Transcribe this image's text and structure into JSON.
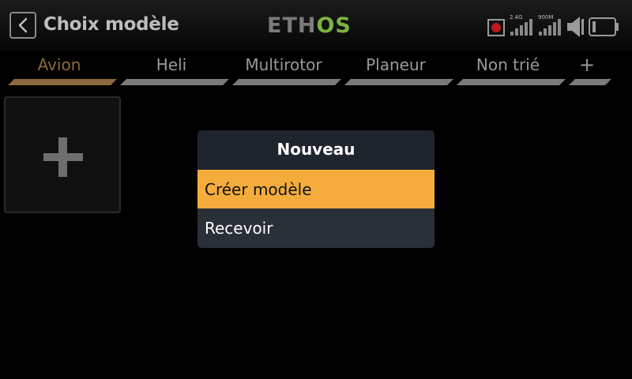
{
  "header": {
    "title": "Choix modèle",
    "back_icon": "chevron-left-icon",
    "logo": {
      "eth": "ETH",
      "os": "OS",
      "accent": "#7cb342"
    },
    "status": {
      "rf_label": "2.4G",
      "telemetry_label": "900M"
    }
  },
  "tabs": [
    {
      "label": "Avion",
      "active": true
    },
    {
      "label": "Heli",
      "active": false
    },
    {
      "label": "Multirotor",
      "active": false
    },
    {
      "label": "Planeur",
      "active": false
    },
    {
      "label": "Non trié",
      "active": false
    },
    {
      "label": "+",
      "active": false
    }
  ],
  "add_model_tile": {
    "icon": "plus-icon"
  },
  "popup": {
    "title": "Nouveau",
    "items": [
      {
        "label": "Créer modèle",
        "selected": true
      },
      {
        "label": "Recevoir",
        "selected": false
      }
    ]
  },
  "colors": {
    "accent": "#f4ad3d",
    "active_tab": "#8a6a3c",
    "popup_bg": "#1f252d"
  }
}
